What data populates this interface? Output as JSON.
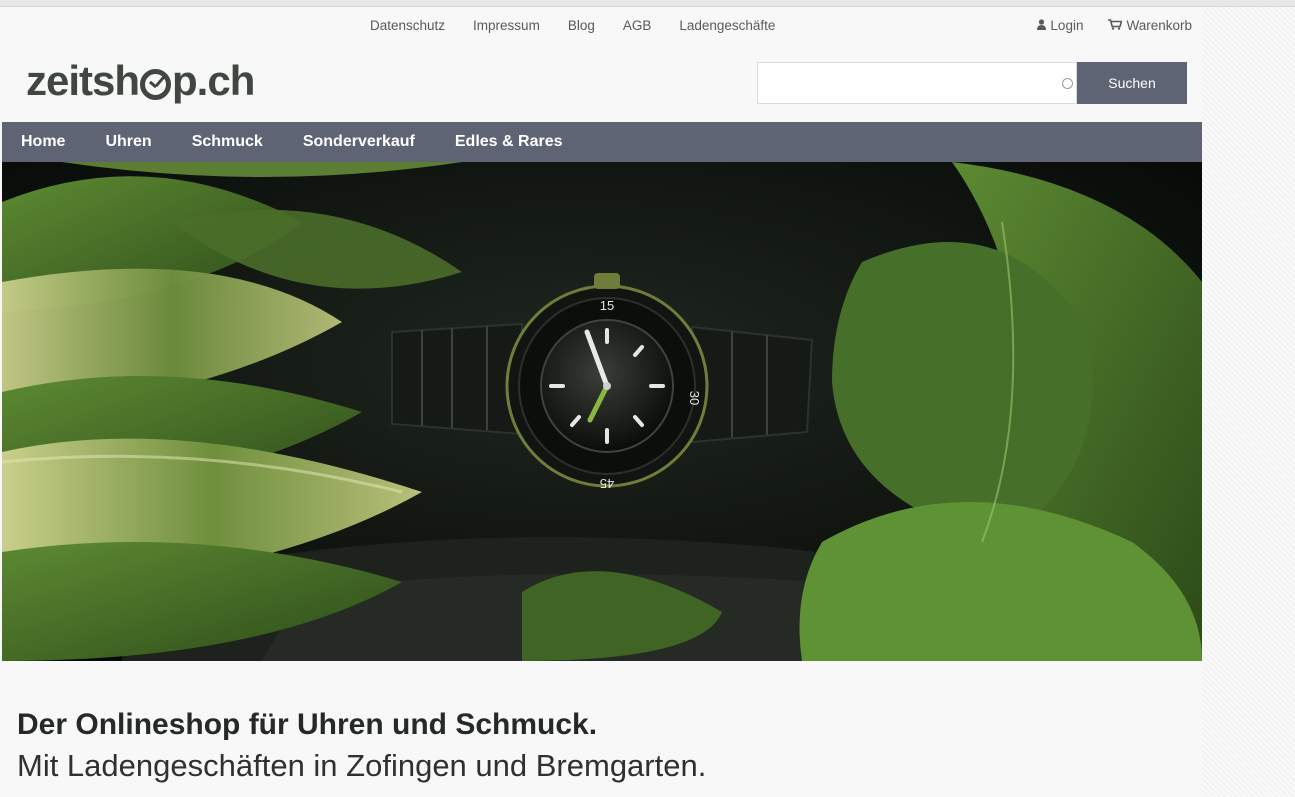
{
  "topbar": {
    "links": [
      "Datenschutz",
      "Impressum",
      "Blog",
      "AGB",
      "Ladengeschäfte"
    ],
    "login": "Login",
    "cart": "Warenkorb"
  },
  "header": {
    "logo": "zeitshop.ch",
    "logo_parts": [
      "zeitsh",
      "p.ch"
    ],
    "search": {
      "placeholder": "",
      "value": "",
      "button": "Suchen"
    }
  },
  "nav": {
    "items": [
      "Home",
      "Uhren",
      "Schmuck",
      "Sonderverkauf",
      "Edles & Rares"
    ]
  },
  "hero": {
    "image": "watch-among-leaves",
    "bezel_markers": [
      "15",
      "30",
      "45"
    ]
  },
  "tagline": {
    "headline": "Der Onlineshop für Uhren und Schmuck.",
    "subline": "Mit Ladengeschäften in Zofingen und Bremgarten."
  },
  "colors": {
    "nav_bg": "#5e6473",
    "logo": "#3f4740",
    "accent_green": "#8bb640"
  },
  "icons": [
    "user-icon",
    "cart-icon",
    "search-icon"
  ]
}
